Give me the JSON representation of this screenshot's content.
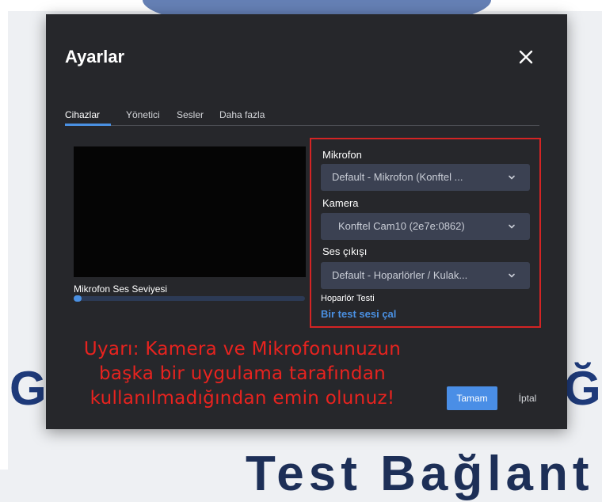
{
  "background": {
    "left_letters": "GE",
    "right_letters": "Ğ",
    "bottom_text": "Test Bağlant"
  },
  "dialog": {
    "title": "Ayarlar",
    "close_icon": "close-icon"
  },
  "tabs": [
    {
      "label": "Cihazlar",
      "active": true
    },
    {
      "label": "Yönetici",
      "active": false
    },
    {
      "label": "Sesler",
      "active": false
    },
    {
      "label": "Daha fazla",
      "active": false
    }
  ],
  "video": {
    "level_label": "Mikrofon Ses Seviyesi",
    "level_fraction": 0.02
  },
  "devices": {
    "microphone": {
      "label": "Mikrofon",
      "value": "Default - Mikrofon (Konftel ..."
    },
    "camera": {
      "label": "Kamera",
      "value": "Konftel Cam10 (2e7e:0862)"
    },
    "speaker": {
      "label": "Ses çıkışı",
      "value": "Default - Hoparlörler / Kulak..."
    },
    "speaker_test": {
      "label": "Hoparlör Testi",
      "link": "Bir test sesi çal"
    }
  },
  "warning": {
    "line1": "Uyarı: Kamera ve Mikrofonunuzun",
    "line2": "başka bir uygulama tarafından",
    "line3": "kullanılmadığından emin olunuz!"
  },
  "footer": {
    "ok_label": "Tamam",
    "cancel_label": "İptal"
  },
  "colors": {
    "dialog_bg": "#26272b",
    "accent": "#4a90e2",
    "highlight_border": "#d42424",
    "warning_text": "#e8231f"
  }
}
